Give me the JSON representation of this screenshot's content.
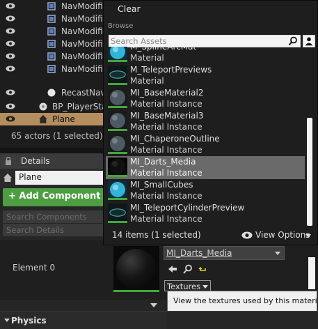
{
  "outliner": {
    "rows": [
      {
        "label": "NavModifie",
        "icon": "nav-modifier-volume-icon"
      },
      {
        "label": "NavModifie",
        "icon": "nav-modifier-volume-icon"
      },
      {
        "label": "NavModifie",
        "icon": "nav-modifier-volume-icon"
      },
      {
        "label": "NavModifie",
        "icon": "nav-modifier-volume-icon"
      },
      {
        "label": "NavModifie",
        "icon": "nav-modifier-volume-icon"
      },
      {
        "label": "NavModifie",
        "icon": "nav-modifier-volume-icon"
      },
      {
        "label": "RecastNavM",
        "icon": "sphere-icon"
      },
      {
        "label": "BP_PlayerSta",
        "icon": "player-start-icon"
      },
      {
        "label": "Plane",
        "icon": "actor-house-icon"
      }
    ],
    "actor_count": "65 actors (1 selected)"
  },
  "details": {
    "tab_label": "Details",
    "actor_name": "Plane",
    "add_component_label": "+ Add Component",
    "search_components_placeholder": "Search Components",
    "search_details_placeholder": "Search Details",
    "element_label": "Element 0",
    "physics_label": "Physics"
  },
  "material_slot": {
    "selected_material": "MI_Darts_Media",
    "textures_label": "Textures",
    "tooltip": "View the textures used by this material"
  },
  "asset_picker": {
    "clear_label": "Clear",
    "browse_label": "Browse",
    "search_placeholder": "Search Assets",
    "items": [
      {
        "name": "M_SplineArcMat",
        "kind": "Material",
        "thumb": "cyan-sphere",
        "selected": false
      },
      {
        "name": "M_TeleportPreviews",
        "kind": "Material",
        "thumb": "teal-ring",
        "selected": false
      },
      {
        "name": "MI_BaseMaterial2",
        "kind": "Material Instance",
        "thumb": "gray-sphere",
        "selected": false
      },
      {
        "name": "MI_BaseMaterial3",
        "kind": "Material Instance",
        "thumb": "gray-sphere",
        "selected": false
      },
      {
        "name": "MI_ChaperoneOutline",
        "kind": "Material Instance",
        "thumb": "gray-sphere",
        "selected": false
      },
      {
        "name": "MI_Darts_Media",
        "kind": "Material Instance",
        "thumb": "black-sphere",
        "selected": true
      },
      {
        "name": "MI_SmallCubes",
        "kind": "Material Instance",
        "thumb": "cyan-sphere",
        "selected": false
      },
      {
        "name": "MI_TeleportCylinderPreview",
        "kind": "Material Instance",
        "thumb": "teal-ring",
        "selected": false
      }
    ],
    "footer_count": "14 items (1 selected)",
    "view_options_label": "View Options"
  },
  "colors": {
    "selection_orange": "#b58e5f",
    "add_component_green": "#4d9e41",
    "material_bar_green": "#3fa83a"
  }
}
